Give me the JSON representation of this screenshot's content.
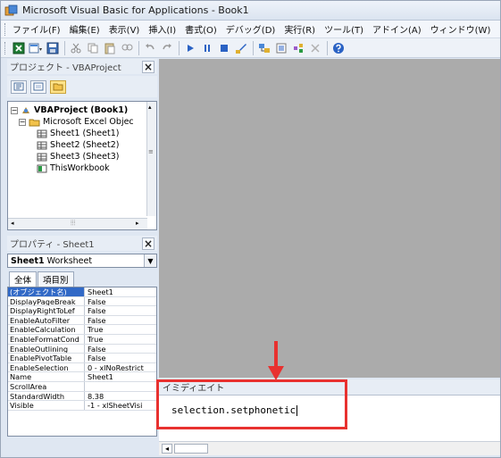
{
  "window": {
    "title": "Microsoft Visual Basic for Applications - Book1"
  },
  "menu": [
    "ファイル(F)",
    "編集(E)",
    "表示(V)",
    "挿入(I)",
    "書式(O)",
    "デバッグ(D)",
    "実行(R)",
    "ツール(T)",
    "アドイン(A)",
    "ウィンドウ(W)"
  ],
  "toolbar": {
    "buttons": [
      "excel-icon",
      "insert-module-icon",
      "save-icon",
      "cut-icon",
      "copy-icon",
      "paste-icon",
      "find-icon",
      "undo-icon",
      "redo-icon",
      "run-icon",
      "break-icon",
      "reset-icon",
      "design-mode-icon",
      "project-explorer-icon",
      "properties-icon",
      "object-browser-icon",
      "toolbox-icon",
      "help-icon"
    ]
  },
  "project_pane": {
    "title": "プロジェクト - VBAProject",
    "close": "×",
    "tree": {
      "root": "VBAProject (Book1)",
      "folder": "Microsoft Excel Objec",
      "items": [
        "Sheet1 (Sheet1)",
        "Sheet2 (Sheet2)",
        "Sheet3 (Sheet3)",
        "ThisWorkbook"
      ]
    }
  },
  "properties_pane": {
    "title": "プロパティ - Sheet1",
    "close": "×",
    "object_name": "Sheet1",
    "object_type": "Worksheet",
    "tabs": [
      "全体",
      "項目別"
    ],
    "rows": [
      {
        "key": "(オブジェクト名)",
        "value": "Sheet1"
      },
      {
        "key": "DisplayPageBreak",
        "value": "False"
      },
      {
        "key": "DisplayRightToLef",
        "value": "False"
      },
      {
        "key": "EnableAutoFilter",
        "value": "False"
      },
      {
        "key": "EnableCalculation",
        "value": "True"
      },
      {
        "key": "EnableFormatCond",
        "value": "True"
      },
      {
        "key": "EnableOutlining",
        "value": "False"
      },
      {
        "key": "EnablePivotTable",
        "value": "False"
      },
      {
        "key": "EnableSelection",
        "value": "0 - xlNoRestrict"
      },
      {
        "key": "Name",
        "value": "Sheet1"
      },
      {
        "key": "ScrollArea",
        "value": ""
      },
      {
        "key": "StandardWidth",
        "value": "8.38"
      },
      {
        "key": "Visible",
        "value": "-1 - xlSheetVisi"
      }
    ]
  },
  "immediate": {
    "title": "イミディエイト",
    "text": "selection.setphonetic"
  },
  "colors": {
    "highlight": "#e8312f",
    "selection": "#3169c6",
    "workspace": "#ababab"
  }
}
